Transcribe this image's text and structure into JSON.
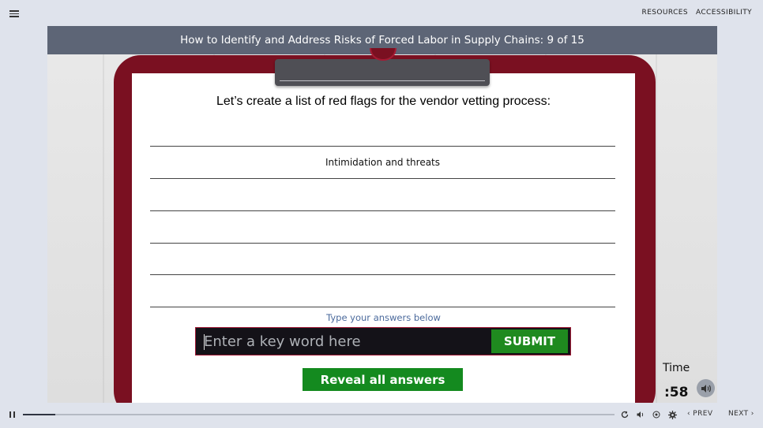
{
  "top_nav": {
    "resources": "RESOURCES",
    "accessibility": "ACCESSIBILITY"
  },
  "slide": {
    "title": "How to Identify and Address Risks of Forced Labor in Supply Chains: 9 of 15",
    "prompt": "Let’s create a list of red flags for the vendor vetting process:",
    "answers": [
      "",
      "Intimidation and threats",
      "",
      "",
      "",
      ""
    ],
    "hint": "Type your answers below",
    "input_placeholder": "Enter a key word here",
    "submit_label": "SUBMIT",
    "reveal_label": "Reveal all answers",
    "time_label": "Time",
    "time_value": ":58"
  },
  "player": {
    "progress_fraction": 0.055,
    "prev_label": "PREV",
    "next_label": "NEXT"
  },
  "colors": {
    "clipboard": "#7a1021",
    "title_bar": "#5d6576",
    "button_green": "#148a1f",
    "hint_blue": "#4b6a9c"
  },
  "icons": [
    "menu-icon",
    "pause-icon",
    "replay-icon",
    "volume-icon",
    "captions-icon",
    "settings-icon",
    "chevron-left-icon",
    "chevron-right-icon",
    "speaker-icon"
  ]
}
